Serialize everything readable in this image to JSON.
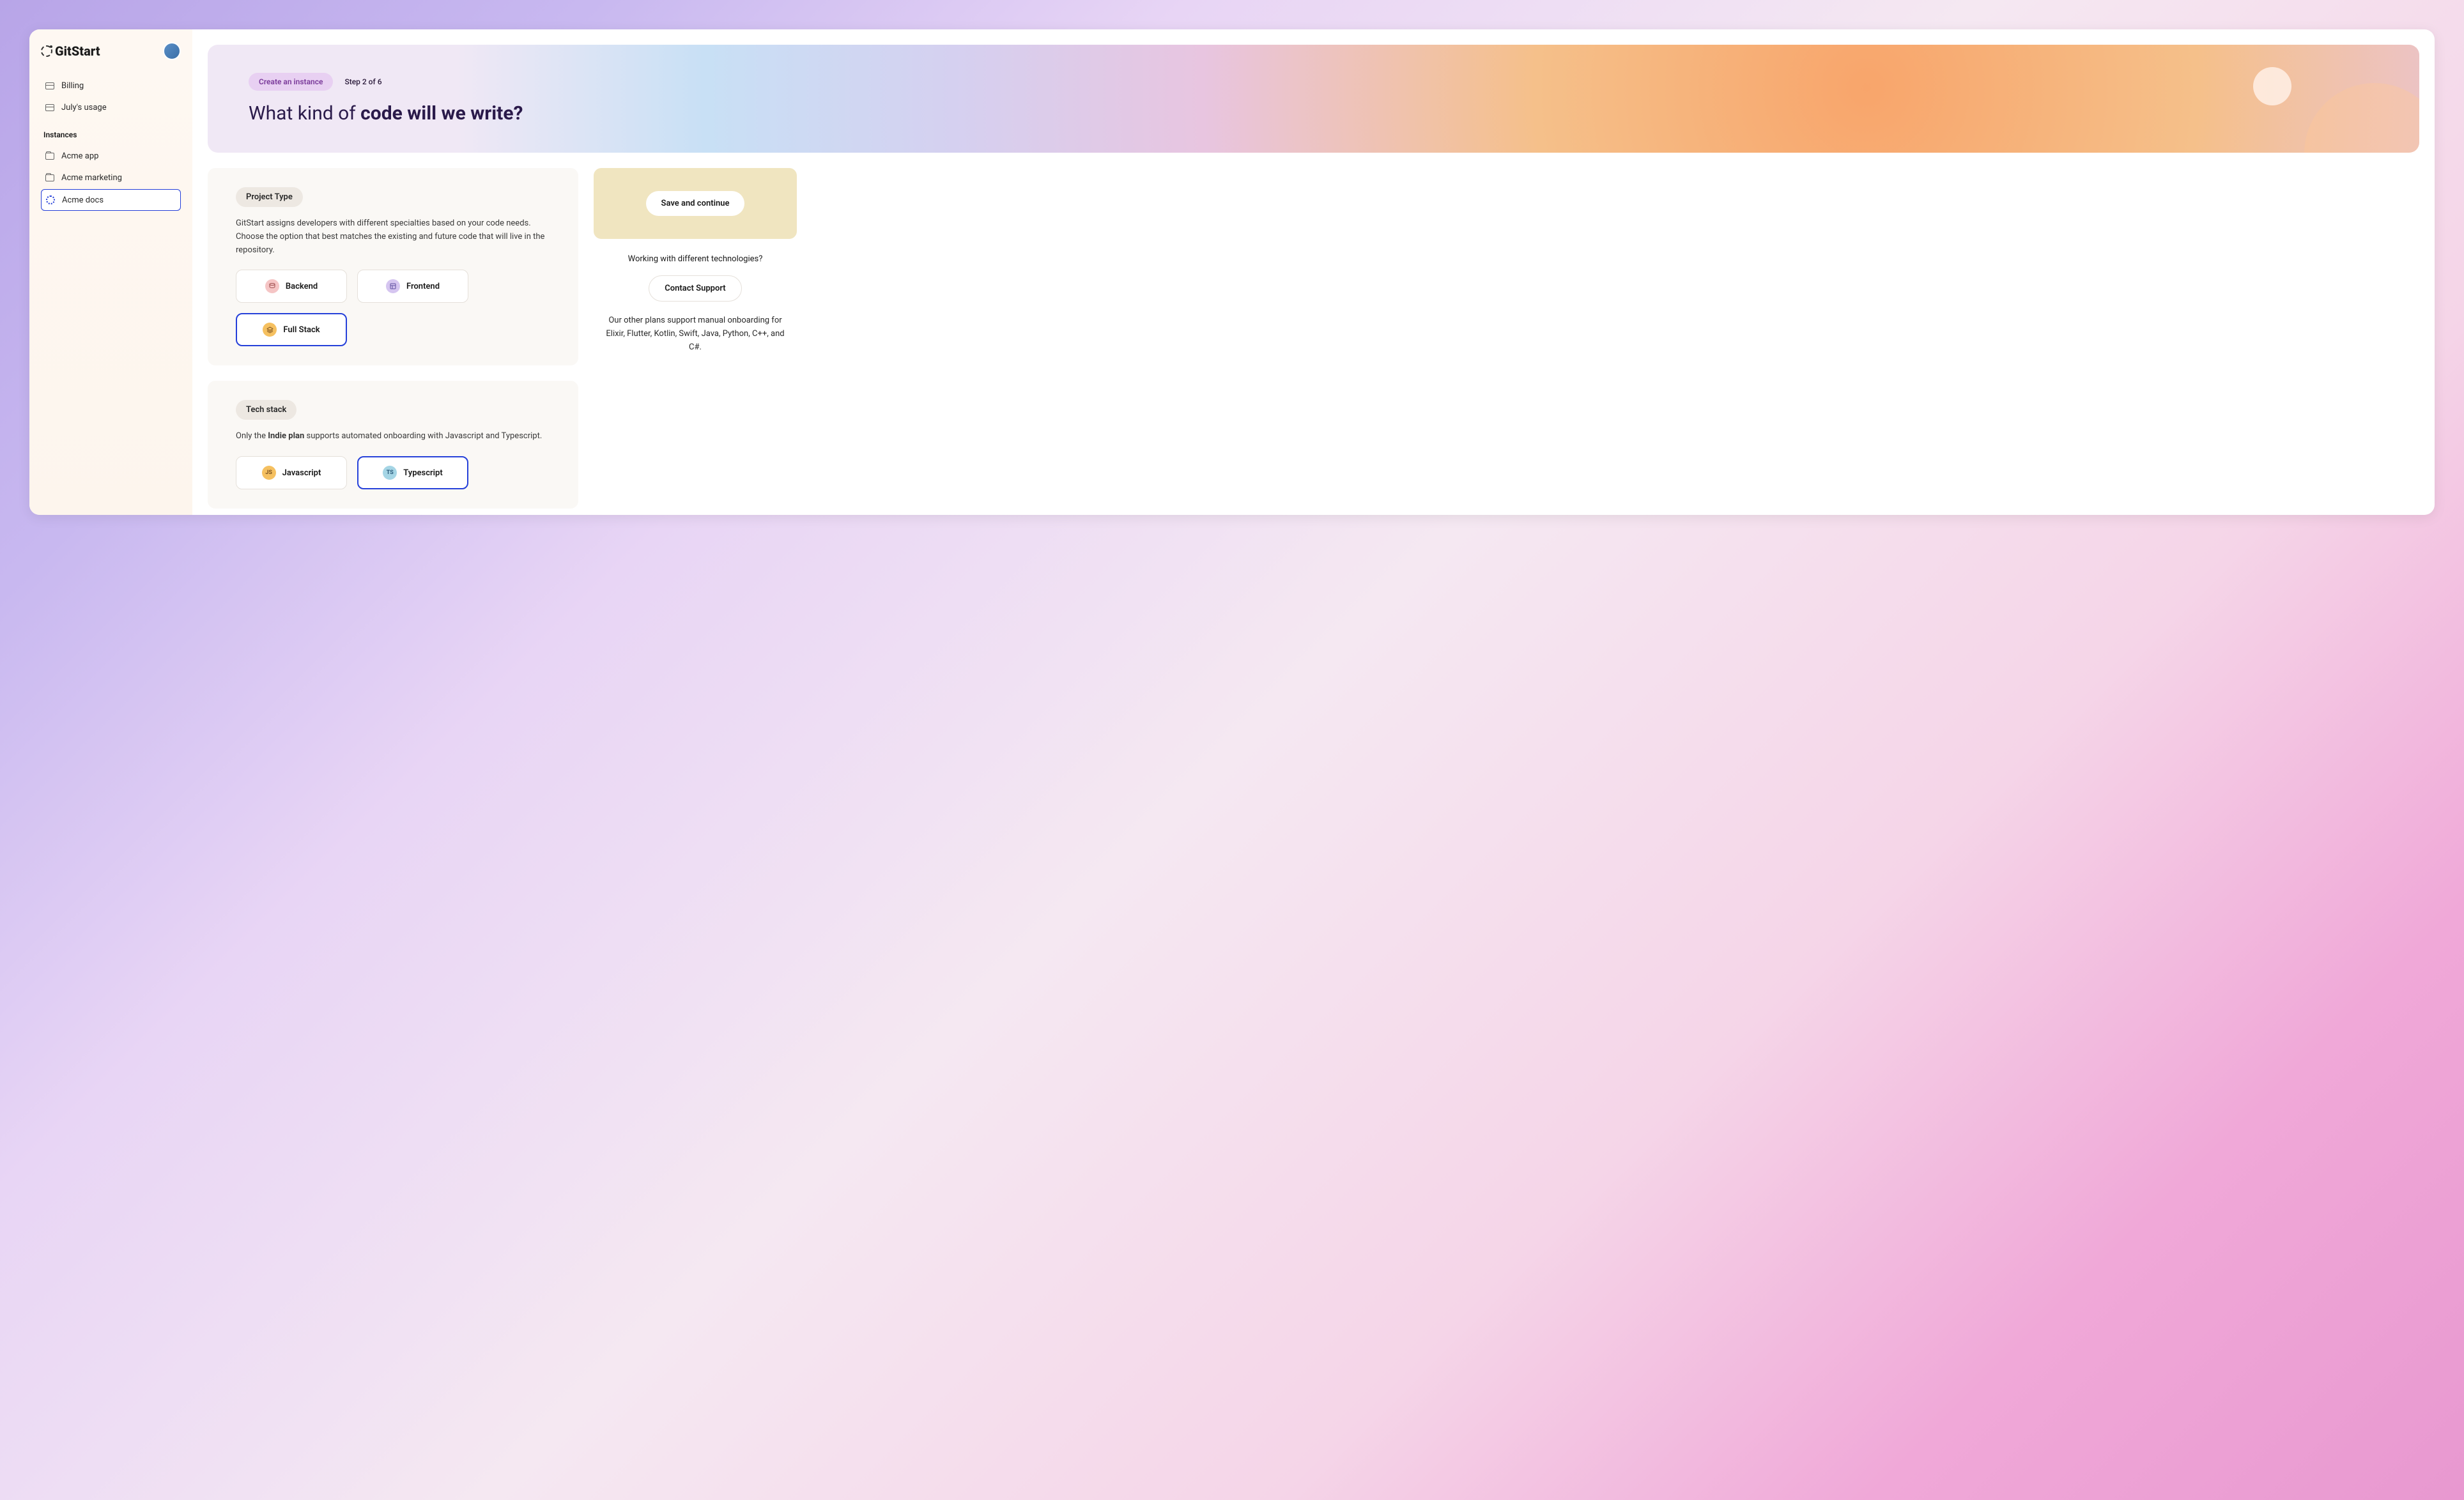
{
  "brand": "GitStart",
  "sidebar": {
    "billing": "Billing",
    "usage": "July's usage",
    "instances_label": "Instances",
    "instances": [
      "Acme app",
      "Acme marketing",
      "Acme docs"
    ]
  },
  "hero": {
    "badge": "Create an instance",
    "step": "Step 2 of 6",
    "title_a": "What kind of ",
    "title_b": "code will we write?"
  },
  "project_type": {
    "label": "Project Type",
    "desc": "GitStart assigns developers with different specialties based on your code needs. Choose the option that best matches the existing and future code that will live in the repository.",
    "backend": "Backend",
    "frontend": "Frontend",
    "fullstack": "Full Stack"
  },
  "tech_stack": {
    "label": "Tech stack",
    "desc_a": "Only the ",
    "desc_b": "Indie plan",
    "desc_c": " supports automated onboarding with Javascript and Typescript.",
    "js": "Javascript",
    "js_badge": "JS",
    "ts": "Typescript",
    "ts_badge": "TS"
  },
  "right": {
    "save": "Save and continue",
    "support_title": "Working with different technologies?",
    "support_btn": "Contact Support",
    "support_desc": "Our other plans support manual onboarding for Elixir, Flutter, Kotlin, Swift, Java, Python, C++, and C#."
  }
}
